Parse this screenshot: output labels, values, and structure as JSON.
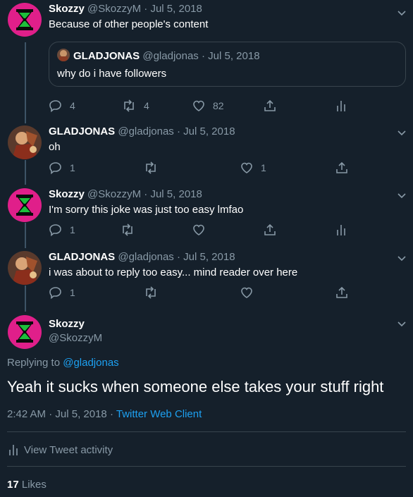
{
  "colors": {
    "background": "#15202b",
    "text": "#ffffff",
    "muted": "#8899a6",
    "accent": "#1da1f2",
    "border": "#38444d"
  },
  "tweets": [
    {
      "name": "Skozzy",
      "handle": "@SkozzyM",
      "date": "Jul 5, 2018",
      "text": "Because of other people's content",
      "avatar": "hourglass-avatar",
      "quote": {
        "name": "GLADJONAS",
        "handle": "@gladjonas",
        "date": "Jul 5, 2018",
        "text": "why do i have followers"
      },
      "replies": "4",
      "retweets": "4",
      "likes": "82"
    },
    {
      "name": "GLADJONAS",
      "handle": "@gladjonas",
      "date": "Jul 5, 2018",
      "text": "oh",
      "avatar": "character-avatar",
      "replies": "1",
      "retweets": "",
      "likes": "1"
    },
    {
      "name": "Skozzy",
      "handle": "@SkozzyM",
      "date": "Jul 5, 2018",
      "text": "I'm sorry this joke was just too easy lmfao",
      "avatar": "hourglass-avatar",
      "replies": "1",
      "retweets": "",
      "likes": ""
    },
    {
      "name": "GLADJONAS",
      "handle": "@gladjonas",
      "date": "Jul 5, 2018",
      "text": "i was about to reply too easy... mind reader over here",
      "avatar": "character-avatar",
      "replies": "1",
      "retweets": "",
      "likes": ""
    }
  ],
  "main_tweet": {
    "name": "Skozzy",
    "handle": "@SkozzyM",
    "replying_prefix": "Replying to",
    "replying_to": "@gladjonas",
    "text": "Yeah it sucks when someone else takes your stuff right",
    "time": "2:42 AM",
    "date": "Jul 5, 2018",
    "client": "Twitter Web Client",
    "activity_label": "View Tweet activity",
    "likes_count": "17",
    "likes_label": "Likes"
  },
  "separator": "·"
}
